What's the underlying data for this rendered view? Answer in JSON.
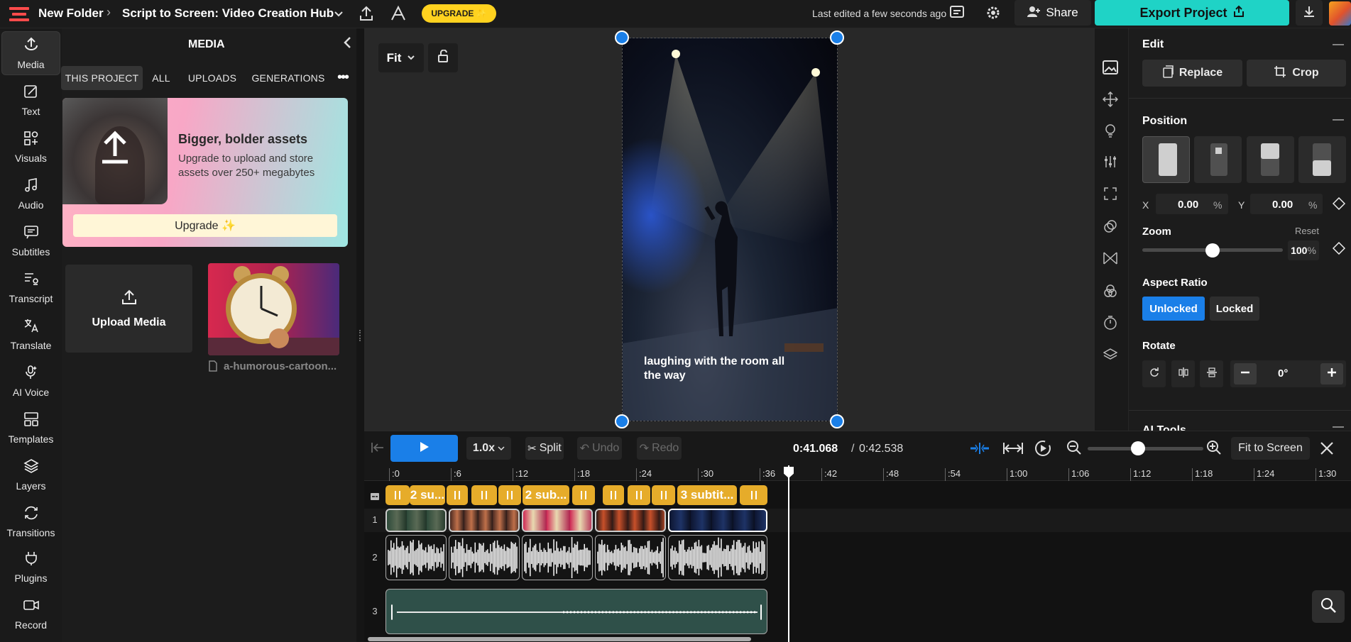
{
  "topbar": {
    "folder": "New Folder",
    "project_title": "Script to Screen: Video Creation Hub",
    "upgrade_label": "UPGRADE ✨",
    "last_edited": "Last edited a few seconds ago",
    "share_label": "Share",
    "export_label": "Export Project"
  },
  "rail": {
    "items": [
      {
        "label": "Media",
        "icon": "media-upload-icon"
      },
      {
        "label": "Text",
        "icon": "text-edit-icon"
      },
      {
        "label": "Visuals",
        "icon": "visuals-icon"
      },
      {
        "label": "Audio",
        "icon": "music-note-icon"
      },
      {
        "label": "Subtitles",
        "icon": "subtitles-icon"
      },
      {
        "label": "Transcript",
        "icon": "transcript-icon"
      },
      {
        "label": "Translate",
        "icon": "translate-icon"
      },
      {
        "label": "AI Voice",
        "icon": "ai-voice-icon"
      },
      {
        "label": "Templates",
        "icon": "templates-icon"
      },
      {
        "label": "Layers",
        "icon": "layers-icon"
      },
      {
        "label": "Transitions",
        "icon": "transitions-icon"
      },
      {
        "label": "Plugins",
        "icon": "plug-icon"
      },
      {
        "label": "Record",
        "icon": "record-icon"
      }
    ]
  },
  "media": {
    "heading": "MEDIA",
    "tabs": [
      "THIS PROJECT",
      "ALL",
      "UPLOADS",
      "GENERATIONS"
    ],
    "promo_title": "Bigger, bolder assets",
    "promo_text": "Upgrade to upload and store assets over 250+ megabytes",
    "promo_button": "Upgrade ✨",
    "upload_label": "Upload Media",
    "asset_name": "a-humorous-cartoon..."
  },
  "canvas": {
    "fit_label": "Fit",
    "caption": "laughing with the room all the way"
  },
  "edit_panel": {
    "edit_heading": "Edit",
    "replace_label": "Replace",
    "crop_label": "Crop",
    "position_heading": "Position",
    "x_label": "X",
    "x_value": "0.00",
    "y_label": "Y",
    "y_value": "0.00",
    "percent": "%",
    "zoom_label": "Zoom",
    "reset_label": "Reset",
    "zoom_value": "100",
    "zoom_level": 0.5,
    "aspect_heading": "Aspect Ratio",
    "unlocked_label": "Unlocked",
    "locked_label": "Locked",
    "rotate_heading": "Rotate",
    "rotate_value": "0°",
    "ai_tools_heading": "AI Tools"
  },
  "timeline": {
    "speed": "1.0x",
    "split_label": "Split",
    "undo_label": "Undo",
    "redo_label": "Redo",
    "current_time": "0:41.068",
    "total_time": "0:42.538",
    "fit_screen_label": "Fit to Screen",
    "ticks": [
      ":0",
      ":6",
      ":12",
      ":18",
      ":24",
      ":30",
      ":36",
      ":42",
      ":48",
      ":54",
      "1:00",
      "1:06",
      "1:12",
      "1:18",
      "1:24",
      "1:30"
    ],
    "subtitle_chips": [
      "2 su...",
      "2 sub...",
      "3 subtit..."
    ],
    "track_numbers": [
      "1",
      "2",
      "3"
    ]
  },
  "colors": {
    "accent_teal": "#1fd3c6",
    "upgrade_yellow": "#ffd21f",
    "selection_blue": "#1a7fe8",
    "subtitle_gold": "#e6ac2a"
  }
}
